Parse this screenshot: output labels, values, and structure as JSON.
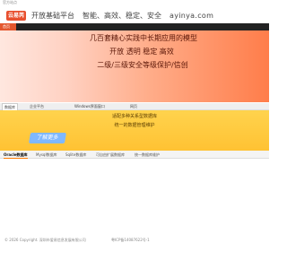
{
  "topbar": {
    "text": "官方站点"
  },
  "header": {
    "logo_text": "云易芮",
    "slogan_main": "开放基础平台",
    "slogan_values": "智能、高效、稳定、安全",
    "site": "ayinya.com"
  },
  "nav1": {
    "tab_label": "首页"
  },
  "hero": {
    "line1": "几百套精心实践中长期应用的模型",
    "line2": "开放   透明   稳定   高效",
    "line3": "二级/三级安全等级保护/信创"
  },
  "nav2": {
    "tabs": [
      "数据库",
      "企业平台",
      "Windows界面窗口",
      "网页"
    ]
  },
  "panel2": {
    "text1": "适配多种关系型数据库",
    "text2": "统一的数据管理维护",
    "learn_more": "了解更多"
  },
  "nav3": {
    "tabs": [
      "Oracle数据库",
      "Mysql数据库",
      "Sqlite数据库",
      "可自由扩展数据库",
      "统一数据库维护"
    ]
  },
  "footer": {
    "copyright": "© 2026 Copyright. 深圳市爱易信息发展有限公司",
    "icp": "粤ICP备14087622号-1"
  },
  "colors": {
    "accent": "#e4572e",
    "hero_gradient_end": "#ff7d4a",
    "panel_yellow": "#ffc233"
  }
}
